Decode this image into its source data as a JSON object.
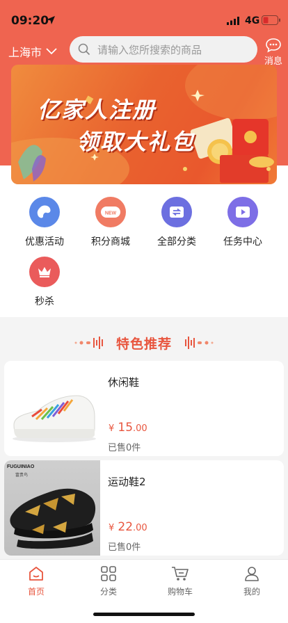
{
  "status_bar": {
    "time": "09:20",
    "network": "4G"
  },
  "header": {
    "city": "上海市",
    "search_placeholder": "请输入您所搜索的商品",
    "message_label": "消息"
  },
  "banner": {
    "line1": "亿家人注册",
    "line2": "领取大礼包"
  },
  "categories": [
    {
      "label": "优惠活动",
      "icon": "bean-icon",
      "color": "#5b88e8"
    },
    {
      "label": "积分商城",
      "icon": "new-badge-icon",
      "color": "#f07b63"
    },
    {
      "label": "全部分类",
      "icon": "exchange-icon",
      "color": "#6c6fe0"
    },
    {
      "label": "任务中心",
      "icon": "play-icon",
      "color": "#7d6ee6"
    },
    {
      "label": "秒杀",
      "icon": "crown-icon",
      "color": "#ea5b5b"
    }
  ],
  "section": {
    "title": "特色推荐"
  },
  "products": [
    {
      "name": "休闲鞋",
      "currency": "¥",
      "price_int": "15",
      "price_dec": ".00",
      "sold": "已售0件"
    },
    {
      "name": "运动鞋2",
      "currency": "¥",
      "price_int": "22",
      "price_dec": ".00",
      "sold": "已售0件",
      "brand": "FUGUINIAO",
      "brand_sub": "富贵鸟"
    }
  ],
  "tabbar": [
    {
      "label": "首页",
      "icon": "home-icon",
      "active": true
    },
    {
      "label": "分类",
      "icon": "grid-icon",
      "active": false
    },
    {
      "label": "购物车",
      "icon": "cart-icon",
      "active": false
    },
    {
      "label": "我的",
      "icon": "user-icon",
      "active": false
    }
  ],
  "colors": {
    "accent": "#ef6450",
    "price": "#e8553e"
  }
}
